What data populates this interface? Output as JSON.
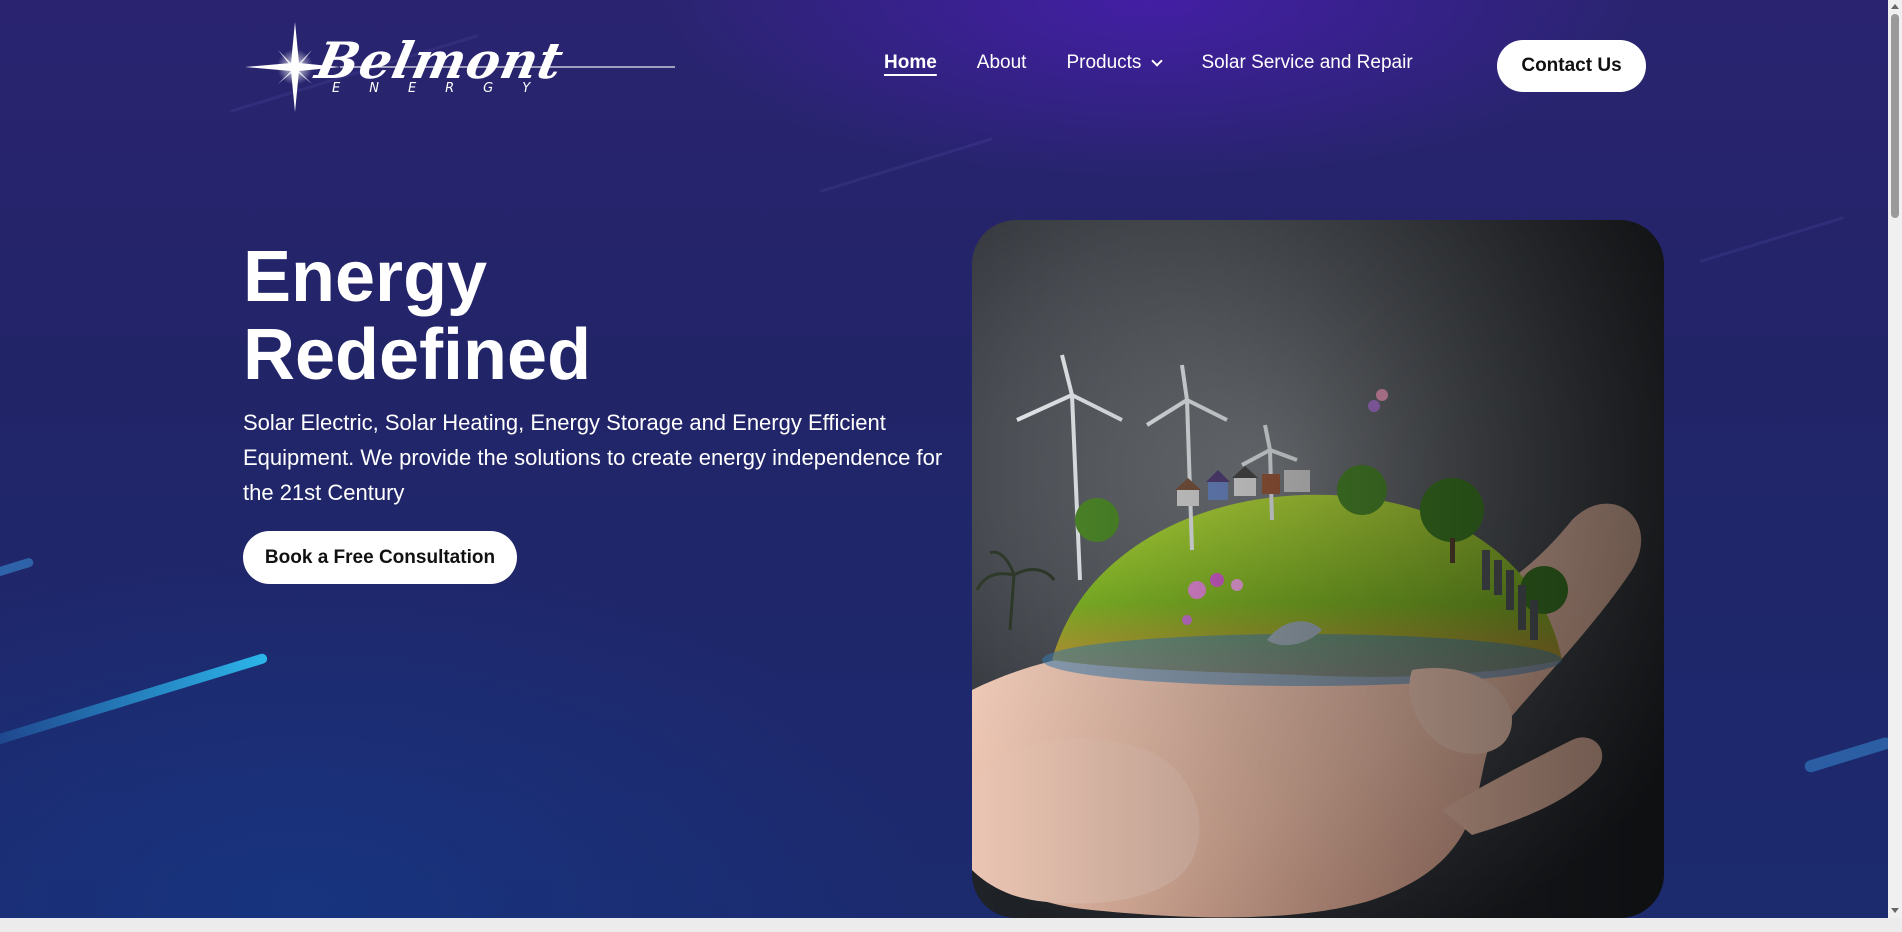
{
  "brand": {
    "name": "Belmont",
    "tagline": "ENERGY"
  },
  "nav": {
    "items": [
      {
        "label": "Home",
        "active": true
      },
      {
        "label": "About",
        "active": false
      },
      {
        "label": "Products",
        "active": false,
        "has_dropdown": true
      },
      {
        "label": "Solar Service and Repair",
        "active": false
      }
    ],
    "contact_label": "Contact Us"
  },
  "hero": {
    "title_line1": "Energy",
    "title_line2": "Redefined",
    "description": "Solar Electric, Solar Heating, Energy Storage and Energy Efficient Equipment. We provide the solutions to create energy independence for the 21st Century",
    "cta_label": "Book a Free Consultation",
    "image_icon": "hand-holding-earth-image"
  },
  "colors": {
    "bg_top": "#2a2470",
    "bg_bottom": "#1c2a6e",
    "accent_streak": "#2bb6ea",
    "button_bg": "#ffffff",
    "button_text": "#111111"
  }
}
